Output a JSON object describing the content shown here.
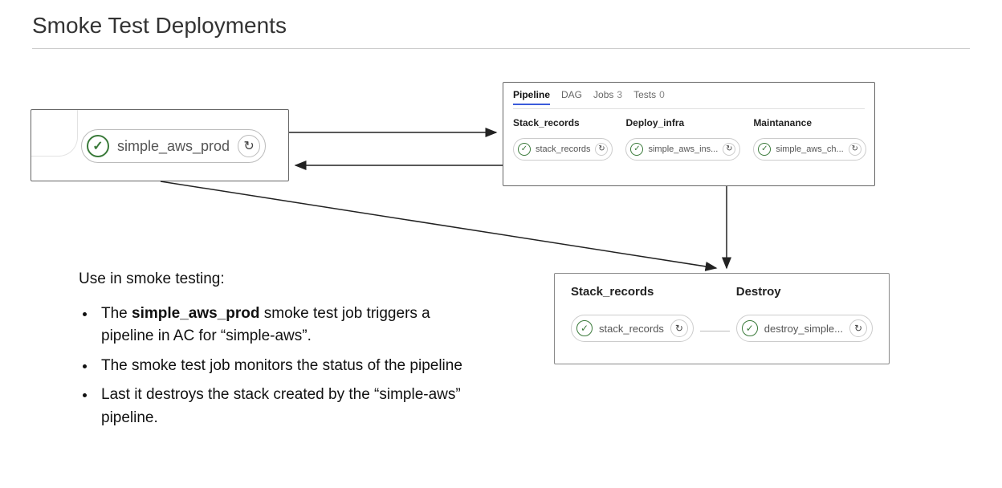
{
  "header": {
    "title": "Smoke Test Deployments"
  },
  "smoke_job": {
    "name": "simple_aws_prod"
  },
  "pipeline_tabs": {
    "pipeline": "Pipeline",
    "dag": "DAG",
    "jobs_label": "Jobs",
    "jobs_count": "3",
    "tests_label": "Tests",
    "tests_count": "0"
  },
  "pipeline1": {
    "stages": [
      {
        "header": "Stack_records",
        "job": "stack_records"
      },
      {
        "header": "Deploy_infra",
        "job": "simple_aws_ins..."
      },
      {
        "header": "Maintanance",
        "job": "simple_aws_ch..."
      }
    ]
  },
  "pipeline2": {
    "stages": [
      {
        "header": "Stack_records",
        "job": "stack_records"
      },
      {
        "header": "Destroy",
        "job": "destroy_simple..."
      }
    ]
  },
  "explain": {
    "lead": "Use in smoke testing:",
    "bullets": [
      {
        "pre": "The ",
        "bold": "simple_aws_prod",
        "post": " smoke test job triggers a pipeline in AC for “simple-aws”."
      },
      {
        "pre": "The smoke test job monitors the status of the pipeline",
        "bold": "",
        "post": ""
      },
      {
        "pre": "Last it destroys the stack created by the “simple-aws” pipeline.",
        "bold": "",
        "post": ""
      }
    ]
  }
}
